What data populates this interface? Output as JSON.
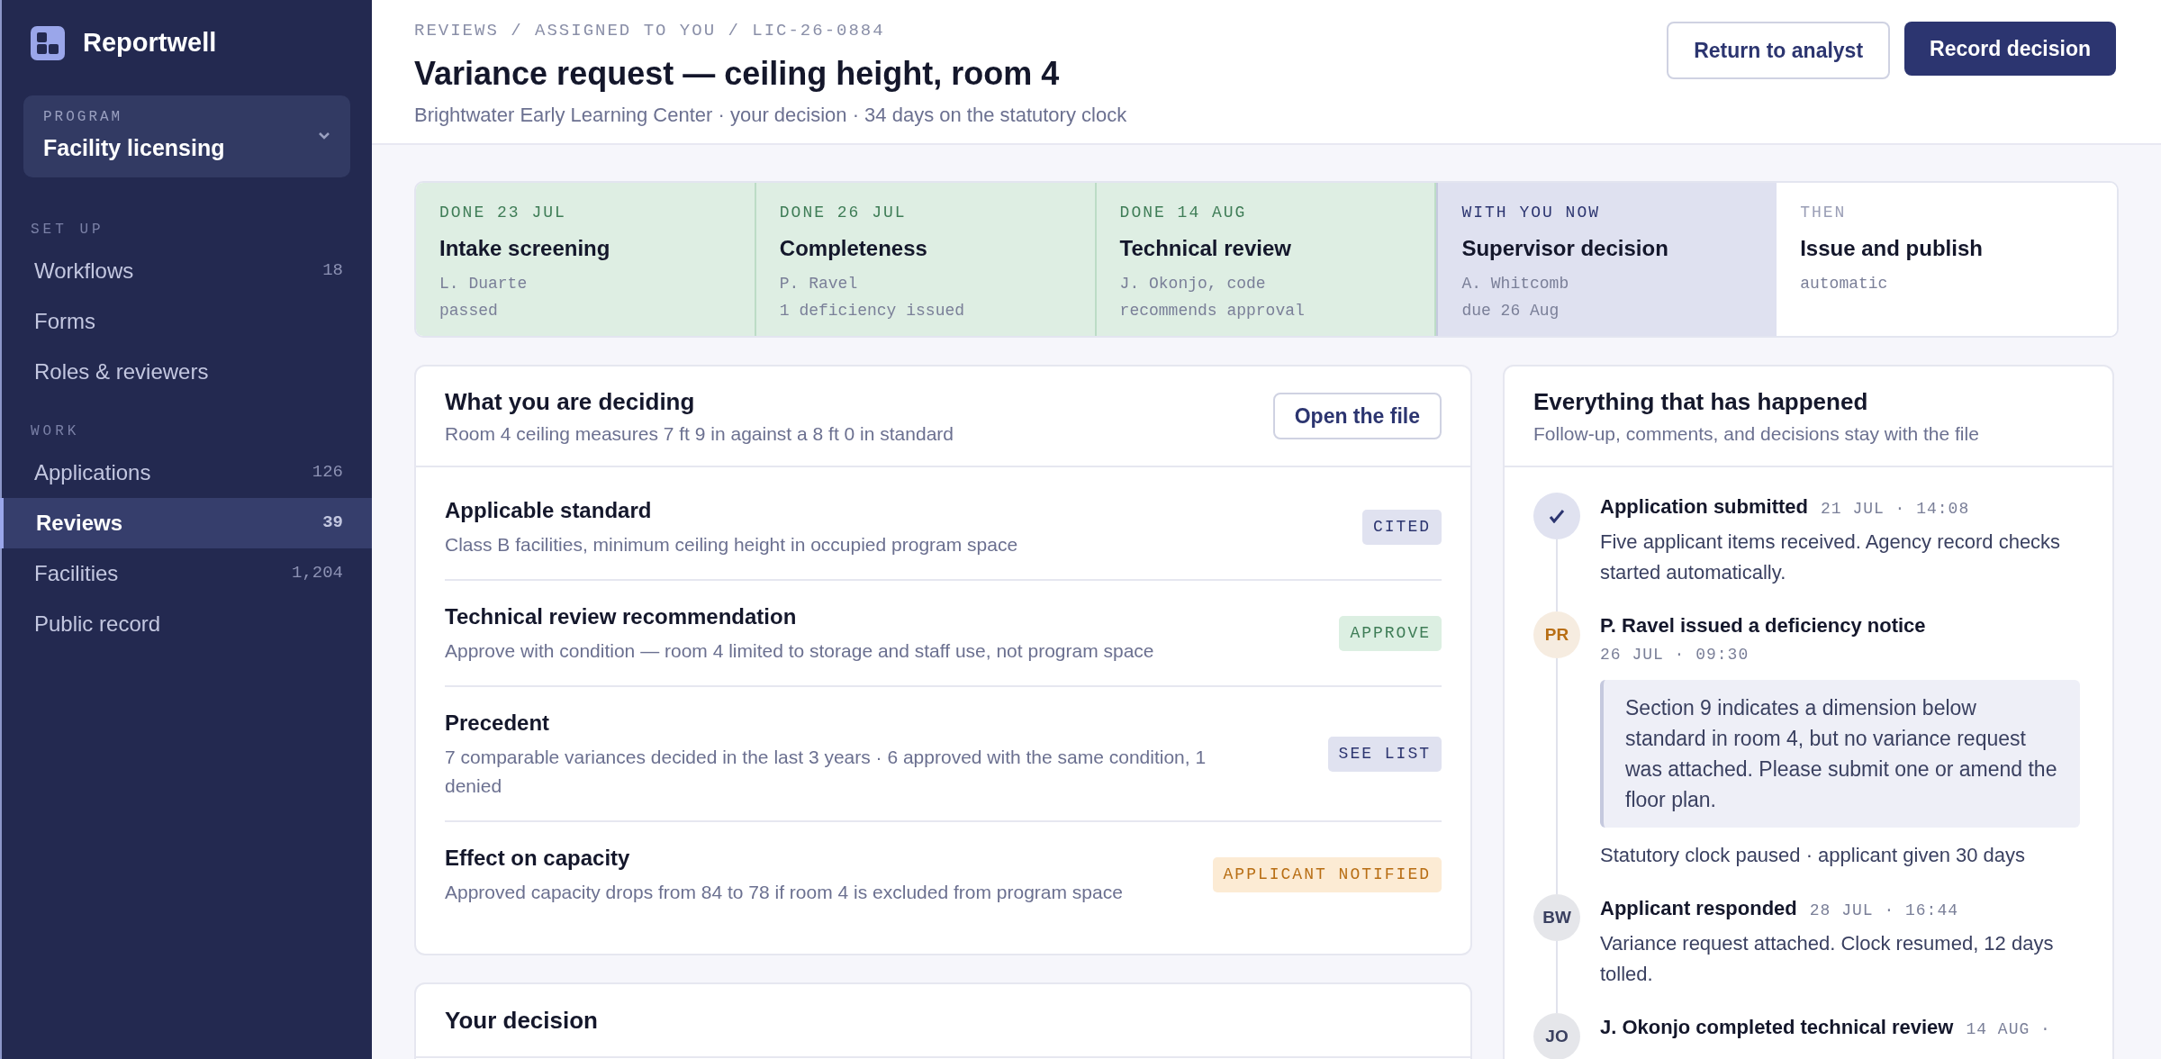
{
  "brand": {
    "name": "Reportwell"
  },
  "program": {
    "label": "PROGRAM",
    "value": "Facility licensing"
  },
  "sidebar": {
    "sections": [
      {
        "title": "SET UP",
        "items": [
          {
            "label": "Workflows",
            "count": "18",
            "selected": false
          },
          {
            "label": "Forms",
            "selected": false
          },
          {
            "label": "Roles & reviewers",
            "selected": false
          }
        ]
      },
      {
        "title": "WORK",
        "items": [
          {
            "label": "Applications",
            "count": "126",
            "selected": false
          },
          {
            "label": "Reviews",
            "count": "39",
            "selected": true
          },
          {
            "label": "Facilities",
            "count": "1,204",
            "selected": false
          },
          {
            "label": "Public record",
            "selected": false
          }
        ]
      }
    ]
  },
  "header": {
    "breadcrumb": "REVIEWS / ASSIGNED TO YOU / LIC-26-0884",
    "title": "Variance request — ceiling height, room 4",
    "subtitle": "Brightwater Early Learning Center · your decision · 34 days on the statutory clock",
    "buttons": [
      {
        "label": "Return to analyst",
        "kind": "secondary"
      },
      {
        "label": "Record decision",
        "kind": "primary"
      }
    ]
  },
  "steps": [
    {
      "kind": "done",
      "label": "DONE 23 JUL",
      "title": "Intake screening",
      "lines": [
        "L. Duarte",
        "passed"
      ]
    },
    {
      "kind": "done",
      "label": "DONE 26 JUL",
      "title": "Completeness",
      "lines": [
        "P. Ravel",
        "1 deficiency issued"
      ]
    },
    {
      "kind": "done",
      "label": "DONE 14 AUG",
      "title": "Technical review",
      "lines": [
        "J. Okonjo, code",
        "recommends approval"
      ]
    },
    {
      "kind": "current",
      "label": "WITH YOU NOW",
      "title": "Supervisor decision",
      "lines": [
        "A. Whitcomb",
        "due 26 Aug"
      ]
    },
    {
      "kind": "upcoming",
      "label": "THEN",
      "title": "Issue and publish",
      "lines": [
        "automatic"
      ]
    }
  ],
  "deciding": {
    "title": "What you are deciding",
    "subtitle": "Room 4 ceiling measures 7 ft 9 in against a 8 ft 0 in standard",
    "button": "Open the file",
    "rows": [
      {
        "title": "Applicable standard",
        "text": "Class B facilities, minimum ceiling height in occupied program space",
        "badge": "CITED",
        "kind": "neutral"
      },
      {
        "title": "Technical review recommendation",
        "text": "Approve with condition — room 4 limited to storage and staff use, not program space",
        "badge": "APPROVE",
        "kind": "positive"
      },
      {
        "title": "Precedent",
        "text": "7 comparable variances decided in the last 3 years · 6 approved with the same condition, 1 denied",
        "badge": "SEE LIST",
        "kind": "neutral"
      },
      {
        "title": "Effect on capacity",
        "text": "Approved capacity drops from 84 to 78 if room 4 is excluded from program space",
        "badge": "APPLICANT NOTIFIED",
        "kind": "warning"
      }
    ]
  },
  "decision": {
    "title": "Your decision"
  },
  "history": {
    "title": "Everything that has happened",
    "subtitle": "Follow-up, comments, and decisions stay with the file",
    "events": [
      {
        "kind": "check",
        "title": "Application submitted",
        "time": "21 JUL · 14:08",
        "text": "Five applicant items received. Agency record checks started automatically."
      },
      {
        "kind": "initials",
        "initials": "PR",
        "color": "#b86e14",
        "title": "P. Ravel issued a deficiency notice",
        "time": "26 JUL · 09:30",
        "quote": "Section 9 indicates a dimension below standard in room 4, but no variance request was attached. Please submit one or amend the floor plan.",
        "text": "Statutory clock paused · applicant given 30 days"
      },
      {
        "kind": "initials",
        "initials": "BW",
        "color": "#3a4060",
        "title": "Applicant responded",
        "time": "28 JUL · 16:44",
        "text": "Variance request attached. Clock resumed, 12 days tolled."
      },
      {
        "kind": "initials",
        "initials": "JO",
        "color": "#3a4060",
        "title": "J. Okonjo completed technical review",
        "time": "14 AUG ·"
      }
    ]
  }
}
